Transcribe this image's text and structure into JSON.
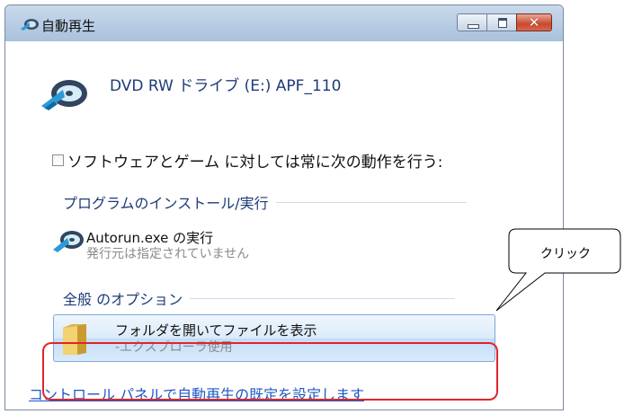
{
  "window": {
    "title": "自動再生",
    "drive_title": "DVD RW ドライブ (E:) APF_110",
    "checkbox_label": "ソフトウェアとゲーム に対しては常に次の動作を行う:",
    "checkbox_checked": false
  },
  "sections": {
    "program": "プログラムのインストール/実行",
    "general": "全般 のオプション"
  },
  "autorun_option": {
    "title": "Autorun.exe の実行",
    "subtitle": "発行元は指定されていません"
  },
  "open_folder_option": {
    "title": "フォルダを開いてファイルを表示",
    "subtitle": "-エクスプローラ使用"
  },
  "control_panel_link": "コントロール パネルで自動再生の既定を設定します",
  "annotation": {
    "callout_text": "クリック",
    "highlight_color": "#e2242a"
  },
  "colors": {
    "link": "#1b57c5",
    "heading": "#1e3b79",
    "close_button": "#c74a2e"
  }
}
